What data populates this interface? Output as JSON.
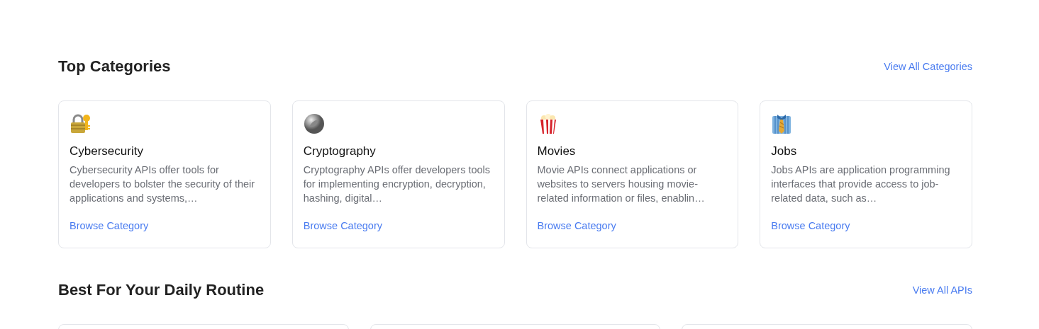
{
  "sections": [
    {
      "title": "Top Categories",
      "link": "View All Categories",
      "cards": [
        {
          "kind": "cybersecurity",
          "title": "Cybersecurity",
          "description": "Cybersecurity APIs offer tools for developers to bolster the security of their applications and systems,…",
          "link": "Browse Category"
        },
        {
          "kind": "cryptography",
          "title": "Cryptography",
          "description": "Cryptography APIs offer developers tools for implementing encryption, decryption, hashing, digital…",
          "link": "Browse Category"
        },
        {
          "kind": "movies",
          "title": "Movies",
          "description": "Movie APIs connect applications or websites to servers housing movie-related information or files, enablin…",
          "link": "Browse Category"
        },
        {
          "kind": "jobs",
          "title": "Jobs",
          "description": "Jobs APIs are application programming interfaces that provide access to job-related data, such as…",
          "link": "Browse Category"
        }
      ]
    },
    {
      "title": "Best For Your Daily Routine",
      "link": "View All APIs",
      "cards": [
        {
          "kind": "empty"
        },
        {
          "kind": "empty"
        },
        {
          "kind": "empty"
        }
      ]
    }
  ]
}
